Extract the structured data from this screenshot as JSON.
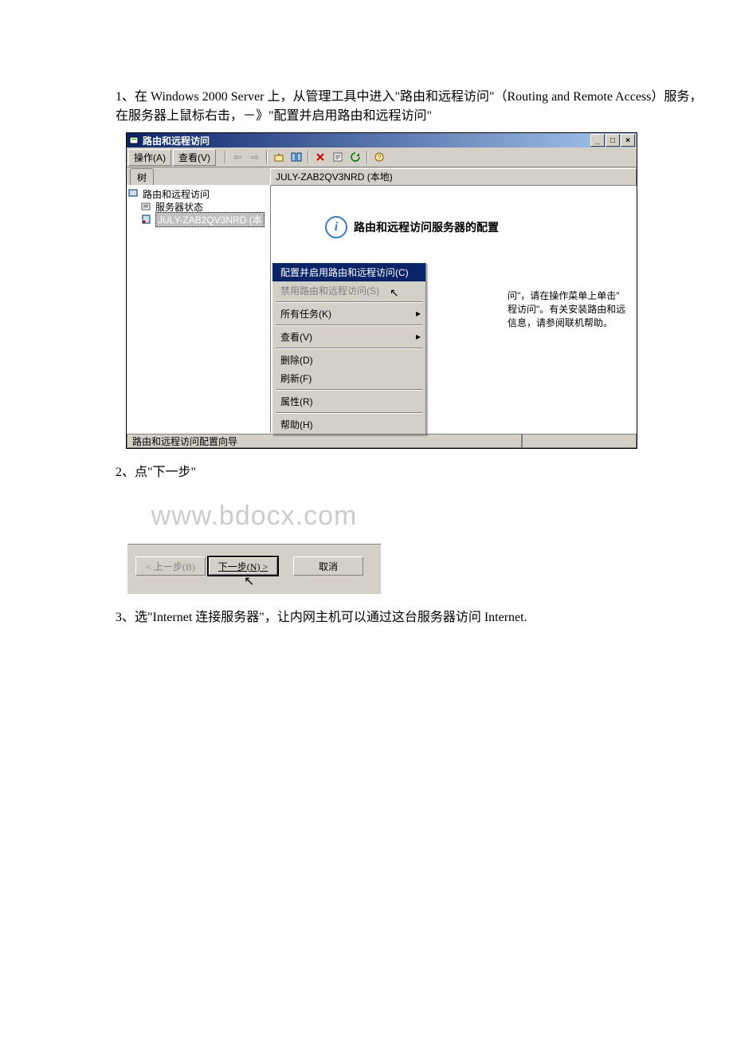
{
  "step1": "1、在 Windows 2000 Server 上，从管理工具中进入\"路由和远程访问\"（Routing and Remote Access）服务，在服务器上鼠标右击，－》\"配置并启用路由和远程访问\"",
  "step2": "2、点\"下一步\"",
  "step3": "3、选\"Internet 连接服务器\"，让内网主机可以通过这台服务器访问 Internet.",
  "watermark": "www.bdocx.com",
  "mmc": {
    "title": "路由和远程访问",
    "menu": {
      "action": "操作(A)",
      "view": "查看(V)"
    },
    "tab": "树",
    "paneHeader": "JULY-ZAB2QV3NRD (本地)",
    "tree": {
      "root": "路由和远程访问",
      "status": "服务器状态",
      "server": "JULY-ZAB2QV3NRD (本"
    },
    "info": {
      "title": "路由和远程访问服务器的配置"
    },
    "hint1": "问\"，请在操作菜单上单击\"",
    "hint2": "程访问\"。有关安装路由和远",
    "hint3": "信息，请参阅联机帮助。",
    "ctx": {
      "configure": "配置并启用路由和远程访问(C)",
      "disable": "禁用路由和远程访问(S)",
      "tasks": "所有任务(K)",
      "view": "查看(V)",
      "delete": "删除(D)",
      "refresh": "刷新(F)",
      "props": "属性(R)",
      "help": "帮助(H)"
    },
    "status": "路由和远程访问配置向导"
  },
  "wizard": {
    "back": "< 上一步(B)",
    "next": "下一步(N) >",
    "cancel": "取消"
  }
}
